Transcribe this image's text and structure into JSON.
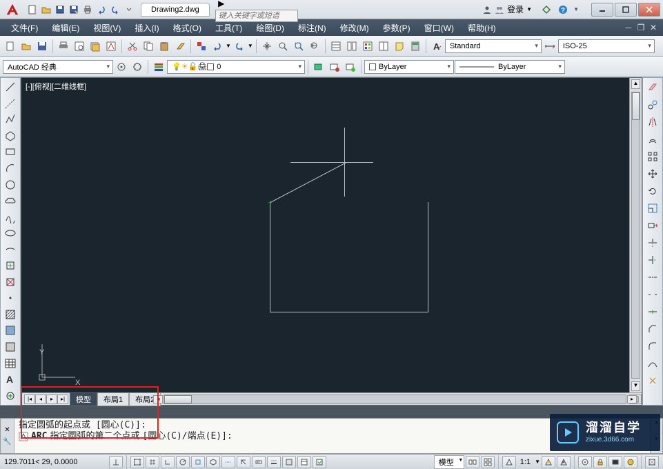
{
  "app": {
    "doc_title": "Drawing2.dwg"
  },
  "search": {
    "placeholder": "键入关键字或短语"
  },
  "login": {
    "label": "登录"
  },
  "menu": {
    "file": "文件(F)",
    "edit": "编辑(E)",
    "view": "视图(V)",
    "insert": "插入(I)",
    "format": "格式(O)",
    "tools": "工具(T)",
    "draw": "绘图(D)",
    "dimension": "标注(N)",
    "modify": "修改(M)",
    "parametric": "参数(P)",
    "window": "窗口(W)",
    "help": "帮助(H)"
  },
  "toolbar1": {
    "workspace": "AutoCAD 经典",
    "layer_current": "0",
    "text_style": "Standard",
    "dim_style": "ISO-25",
    "bylayer": "ByLayer",
    "linetype": "ByLayer"
  },
  "viewport": {
    "label": "[-][俯视][二维线框]"
  },
  "ucs": {
    "x": "X",
    "y": "Y"
  },
  "tabs": {
    "model": "模型",
    "layout1": "布局1",
    "layout2": "布局2"
  },
  "command": {
    "line1": "指定圆弧的起点或 [圆心(C)]:",
    "prefix": "ARC",
    "line2_a": "指定圆弧的第二个点或",
    "line2_b": "[圆心(C)/端点(E)]:"
  },
  "status": {
    "coords": "129.7011< 29",
    "extra": ", 0.0000",
    "model_btn": "模型",
    "scale": "1:1"
  },
  "watermark": {
    "title": "溜溜自学",
    "url": "zixue.3d66.com"
  }
}
